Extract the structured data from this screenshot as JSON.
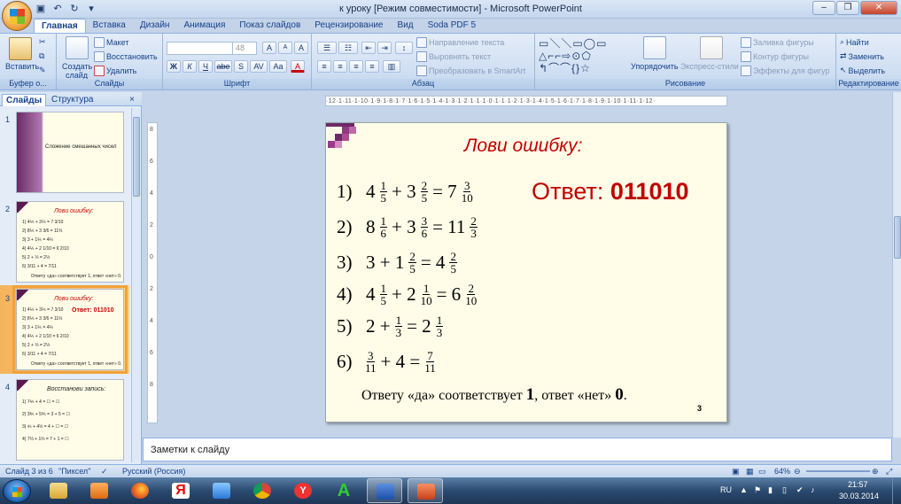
{
  "window": {
    "title": "к уроку [Режим совместимости] - Microsoft PowerPoint",
    "min": "–",
    "max": "❐",
    "close": "✕"
  },
  "ribbon_tabs": [
    "Главная",
    "Вставка",
    "Дизайн",
    "Анимация",
    "Показ слайдов",
    "Рецензирование",
    "Вид",
    "Soda PDF 5"
  ],
  "ribbon": {
    "clipboard": {
      "label": "Буфер о...",
      "paste": "Вставить"
    },
    "slides": {
      "label": "Слайды",
      "create": "Создать",
      "create2": "слайд",
      "layout": "Макет",
      "reset": "Восстановить",
      "delete": "Удалить"
    },
    "font": {
      "label": "Шрифт",
      "size": "48",
      "bold": "Ж",
      "italic": "К",
      "underline": "Ч",
      "strike": "abe",
      "shadow": "S",
      "spacing": "AV",
      "case": "Aa",
      "grow": "A",
      "shrink": "A",
      "clear": "A"
    },
    "paragraph": {
      "label": "Абзац",
      "direction": "Направление текста",
      "align_text": "Выровнять текст",
      "smartart": "Преобразовать в SmartArt"
    },
    "drawing": {
      "label": "Рисование",
      "arrange": "Упорядочить",
      "styles": "Экспресс-стили",
      "fill": "Заливка фигуры",
      "outline": "Контур фигуры",
      "effects": "Эффекты для фигур"
    },
    "editing": {
      "label": "Редактирование",
      "find": "Найти",
      "replace": "Заменить",
      "select": "Выделить"
    }
  },
  "panel": {
    "tab_slides": "Слайды",
    "tab_outline": "Структура",
    "close": "×",
    "thumbs": [
      {
        "num": "1",
        "title": "Сложение смешанных чисел"
      },
      {
        "num": "2",
        "title": "Лови ошибку:",
        "footer": "Ответу «да» соответствует 1, ответ «нет» 0."
      },
      {
        "num": "3",
        "title": "Лови ошибку:",
        "answer": "Ответ: 011010",
        "footer": "Ответу «да» соответствует 1, ответ «нет» 0."
      },
      {
        "num": "4",
        "title": "Восстанови запись:"
      }
    ]
  },
  "ruler": "·12·1·11·1·10·1·9·1·8·1·7·1·6·1·5·1·4·1·3·1·2·1·1·1·0·1·1·1·2·1·3·1·4·1·5·1·6·1·7·1·8·1·9·1·10·1·11·1·12·",
  "slide": {
    "title": "Лови ошибку:",
    "answer_label": "Ответ:",
    "answer_value": "011010",
    "problems": [
      {
        "n": "1)",
        "parts": [
          {
            "t": "4"
          },
          {
            "f": [
              "1",
              "5"
            ]
          },
          {
            "t": "+ 3"
          },
          {
            "f": [
              "2",
              "5"
            ]
          },
          {
            "t": "= 7"
          },
          {
            "f": [
              "3",
              "10"
            ]
          }
        ]
      },
      {
        "n": "2)",
        "parts": [
          {
            "t": "8"
          },
          {
            "f": [
              "1",
              "6"
            ]
          },
          {
            "t": "+ 3"
          },
          {
            "f": [
              "3",
              "6"
            ]
          },
          {
            "t": "= 11"
          },
          {
            "f": [
              "2",
              "3"
            ]
          }
        ]
      },
      {
        "n": "3)",
        "parts": [
          {
            "t": "3 + 1"
          },
          {
            "f": [
              "2",
              "5"
            ]
          },
          {
            "t": "= 4"
          },
          {
            "f": [
              "2",
              "5"
            ]
          }
        ]
      },
      {
        "n": "4)",
        "parts": [
          {
            "t": "4"
          },
          {
            "f": [
              "1",
              "5"
            ]
          },
          {
            "t": "+ 2"
          },
          {
            "f": [
              "1",
              "10"
            ]
          },
          {
            "t": "= 6"
          },
          {
            "f": [
              "2",
              "10"
            ]
          }
        ]
      },
      {
        "n": "5)",
        "parts": [
          {
            "t": "2 +"
          },
          {
            "f": [
              "1",
              "3"
            ]
          },
          {
            "t": "= 2"
          },
          {
            "f": [
              "1",
              "3"
            ]
          }
        ]
      },
      {
        "n": "6)",
        "parts": [
          {
            "f": [
              "3",
              "11"
            ]
          },
          {
            "t": "+ 4 ="
          },
          {
            "f": [
              "7",
              "11"
            ]
          }
        ]
      }
    ],
    "conclusion_a": "Ответу «да» соответствует",
    "conclusion_one": "1",
    "conclusion_b": ", ответ «нет»",
    "conclusion_zero": "0",
    "conclusion_end": ".",
    "page": "3"
  },
  "notes_placeholder": "Заметки к слайду",
  "status": {
    "slide": "Слайд 3 из 6",
    "theme": "\"Пиксел\"",
    "lang": "Русский (Россия)",
    "zoom": "64%"
  },
  "tray": {
    "lang": "RU",
    "time": "21:57",
    "date": "30.03.2014"
  },
  "colors": {
    "accent": "#c00000",
    "slide_bg": "#fffde8",
    "ribbon": "#dbe7f6"
  }
}
